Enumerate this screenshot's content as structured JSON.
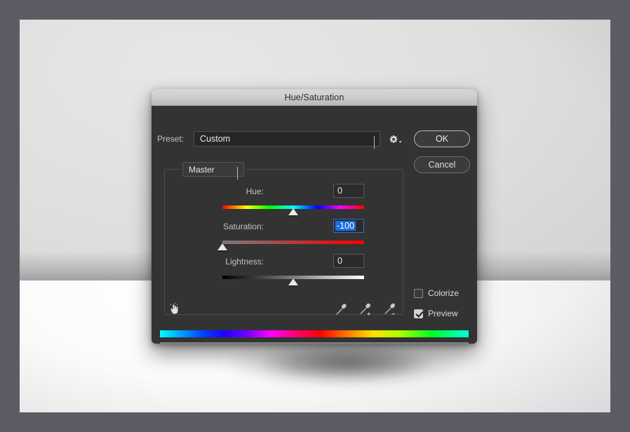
{
  "dialog": {
    "title": "Hue/Saturation",
    "preset": {
      "label": "Preset:",
      "value": "Custom",
      "chevron_icon": "chevron-down-icon"
    },
    "gear_icon": "gear-with-dropdown-icon",
    "buttons": {
      "ok": "OK",
      "cancel": "Cancel"
    },
    "channel": {
      "value": "Master",
      "chevron_icon": "chevron-down-icon"
    },
    "sliders": [
      {
        "name": "hue",
        "label": "Hue:",
        "value": "0",
        "thumb_percent": 50,
        "focused": false
      },
      {
        "name": "saturation",
        "label": "Saturation:",
        "value": "-100",
        "thumb_percent": 0,
        "focused": true
      },
      {
        "name": "lightness",
        "label": "Lightness:",
        "value": "0",
        "thumb_percent": 50,
        "focused": false
      }
    ],
    "tools": {
      "on_image_adjust_icon": "scrubby-hand-icon",
      "eyedropper_icon": "eyedropper-icon",
      "eyedropper_add_icon": "eyedropper-plus-icon",
      "eyedropper_subtract_icon": "eyedropper-minus-icon"
    },
    "checkboxes": [
      {
        "name": "colorize",
        "label": "Colorize",
        "checked": false
      },
      {
        "name": "preview",
        "label": "Preview",
        "checked": true
      }
    ]
  },
  "colors": {
    "dialog_bg": "#333333",
    "titlebar_top": "#d6d6d6",
    "titlebar_bottom": "#b9b9b9",
    "field_bg": "#262626",
    "selection_blue": "#1a6fe0",
    "focus_border": "#2f6fd0",
    "text": "#e8e8e8",
    "label_text": "#c2c2c2",
    "output_bar": "#808080",
    "mat": "#5c5c64"
  }
}
